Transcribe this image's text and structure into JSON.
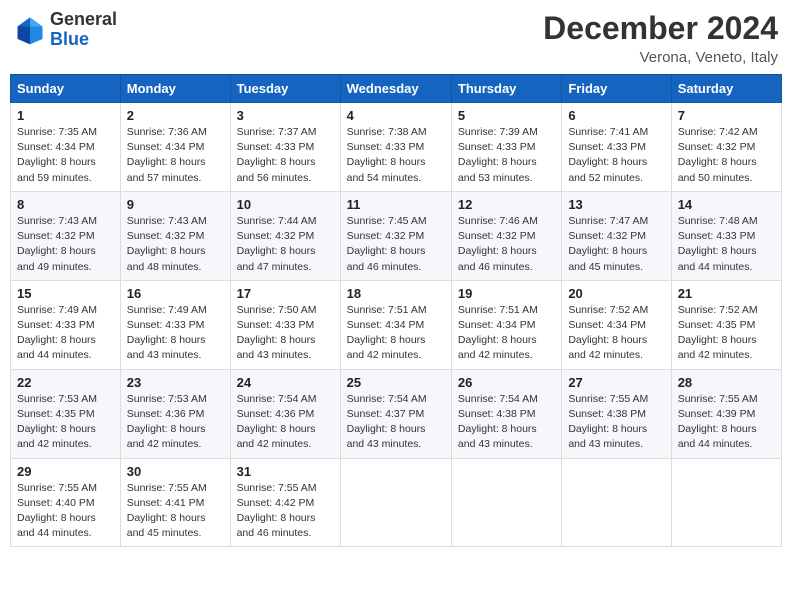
{
  "header": {
    "logo_general": "General",
    "logo_blue": "Blue",
    "month_title": "December 2024",
    "location": "Verona, Veneto, Italy"
  },
  "days_of_week": [
    "Sunday",
    "Monday",
    "Tuesday",
    "Wednesday",
    "Thursday",
    "Friday",
    "Saturday"
  ],
  "weeks": [
    [
      {
        "day": 1,
        "lines": [
          "Sunrise: 7:35 AM",
          "Sunset: 4:34 PM",
          "Daylight: 8 hours",
          "and 59 minutes."
        ]
      },
      {
        "day": 2,
        "lines": [
          "Sunrise: 7:36 AM",
          "Sunset: 4:34 PM",
          "Daylight: 8 hours",
          "and 57 minutes."
        ]
      },
      {
        "day": 3,
        "lines": [
          "Sunrise: 7:37 AM",
          "Sunset: 4:33 PM",
          "Daylight: 8 hours",
          "and 56 minutes."
        ]
      },
      {
        "day": 4,
        "lines": [
          "Sunrise: 7:38 AM",
          "Sunset: 4:33 PM",
          "Daylight: 8 hours",
          "and 54 minutes."
        ]
      },
      {
        "day": 5,
        "lines": [
          "Sunrise: 7:39 AM",
          "Sunset: 4:33 PM",
          "Daylight: 8 hours",
          "and 53 minutes."
        ]
      },
      {
        "day": 6,
        "lines": [
          "Sunrise: 7:41 AM",
          "Sunset: 4:33 PM",
          "Daylight: 8 hours",
          "and 52 minutes."
        ]
      },
      {
        "day": 7,
        "lines": [
          "Sunrise: 7:42 AM",
          "Sunset: 4:32 PM",
          "Daylight: 8 hours",
          "and 50 minutes."
        ]
      }
    ],
    [
      {
        "day": 8,
        "lines": [
          "Sunrise: 7:43 AM",
          "Sunset: 4:32 PM",
          "Daylight: 8 hours",
          "and 49 minutes."
        ]
      },
      {
        "day": 9,
        "lines": [
          "Sunrise: 7:43 AM",
          "Sunset: 4:32 PM",
          "Daylight: 8 hours",
          "and 48 minutes."
        ]
      },
      {
        "day": 10,
        "lines": [
          "Sunrise: 7:44 AM",
          "Sunset: 4:32 PM",
          "Daylight: 8 hours",
          "and 47 minutes."
        ]
      },
      {
        "day": 11,
        "lines": [
          "Sunrise: 7:45 AM",
          "Sunset: 4:32 PM",
          "Daylight: 8 hours",
          "and 46 minutes."
        ]
      },
      {
        "day": 12,
        "lines": [
          "Sunrise: 7:46 AM",
          "Sunset: 4:32 PM",
          "Daylight: 8 hours",
          "and 46 minutes."
        ]
      },
      {
        "day": 13,
        "lines": [
          "Sunrise: 7:47 AM",
          "Sunset: 4:32 PM",
          "Daylight: 8 hours",
          "and 45 minutes."
        ]
      },
      {
        "day": 14,
        "lines": [
          "Sunrise: 7:48 AM",
          "Sunset: 4:33 PM",
          "Daylight: 8 hours",
          "and 44 minutes."
        ]
      }
    ],
    [
      {
        "day": 15,
        "lines": [
          "Sunrise: 7:49 AM",
          "Sunset: 4:33 PM",
          "Daylight: 8 hours",
          "and 44 minutes."
        ]
      },
      {
        "day": 16,
        "lines": [
          "Sunrise: 7:49 AM",
          "Sunset: 4:33 PM",
          "Daylight: 8 hours",
          "and 43 minutes."
        ]
      },
      {
        "day": 17,
        "lines": [
          "Sunrise: 7:50 AM",
          "Sunset: 4:33 PM",
          "Daylight: 8 hours",
          "and 43 minutes."
        ]
      },
      {
        "day": 18,
        "lines": [
          "Sunrise: 7:51 AM",
          "Sunset: 4:34 PM",
          "Daylight: 8 hours",
          "and 42 minutes."
        ]
      },
      {
        "day": 19,
        "lines": [
          "Sunrise: 7:51 AM",
          "Sunset: 4:34 PM",
          "Daylight: 8 hours",
          "and 42 minutes."
        ]
      },
      {
        "day": 20,
        "lines": [
          "Sunrise: 7:52 AM",
          "Sunset: 4:34 PM",
          "Daylight: 8 hours",
          "and 42 minutes."
        ]
      },
      {
        "day": 21,
        "lines": [
          "Sunrise: 7:52 AM",
          "Sunset: 4:35 PM",
          "Daylight: 8 hours",
          "and 42 minutes."
        ]
      }
    ],
    [
      {
        "day": 22,
        "lines": [
          "Sunrise: 7:53 AM",
          "Sunset: 4:35 PM",
          "Daylight: 8 hours",
          "and 42 minutes."
        ]
      },
      {
        "day": 23,
        "lines": [
          "Sunrise: 7:53 AM",
          "Sunset: 4:36 PM",
          "Daylight: 8 hours",
          "and 42 minutes."
        ]
      },
      {
        "day": 24,
        "lines": [
          "Sunrise: 7:54 AM",
          "Sunset: 4:36 PM",
          "Daylight: 8 hours",
          "and 42 minutes."
        ]
      },
      {
        "day": 25,
        "lines": [
          "Sunrise: 7:54 AM",
          "Sunset: 4:37 PM",
          "Daylight: 8 hours",
          "and 43 minutes."
        ]
      },
      {
        "day": 26,
        "lines": [
          "Sunrise: 7:54 AM",
          "Sunset: 4:38 PM",
          "Daylight: 8 hours",
          "and 43 minutes."
        ]
      },
      {
        "day": 27,
        "lines": [
          "Sunrise: 7:55 AM",
          "Sunset: 4:38 PM",
          "Daylight: 8 hours",
          "and 43 minutes."
        ]
      },
      {
        "day": 28,
        "lines": [
          "Sunrise: 7:55 AM",
          "Sunset: 4:39 PM",
          "Daylight: 8 hours",
          "and 44 minutes."
        ]
      }
    ],
    [
      {
        "day": 29,
        "lines": [
          "Sunrise: 7:55 AM",
          "Sunset: 4:40 PM",
          "Daylight: 8 hours",
          "and 44 minutes."
        ]
      },
      {
        "day": 30,
        "lines": [
          "Sunrise: 7:55 AM",
          "Sunset: 4:41 PM",
          "Daylight: 8 hours",
          "and 45 minutes."
        ]
      },
      {
        "day": 31,
        "lines": [
          "Sunrise: 7:55 AM",
          "Sunset: 4:42 PM",
          "Daylight: 8 hours",
          "and 46 minutes."
        ]
      },
      null,
      null,
      null,
      null
    ]
  ]
}
